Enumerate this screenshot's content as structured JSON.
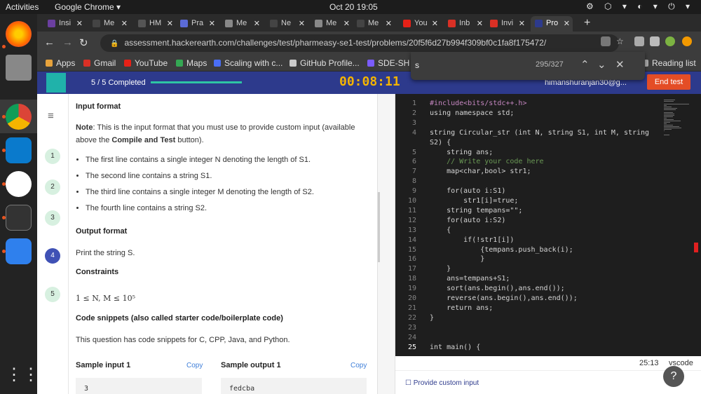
{
  "topbar": {
    "activities": "Activities",
    "app": "Google Chrome ▾",
    "clock": "Oct 20  19:05",
    "tray": "⚙ ⬡ ▾ ◐ ▾ ⏻ ▾"
  },
  "tabs": [
    {
      "label": "Insi",
      "color": "#6b3fa0"
    },
    {
      "label": "Me",
      "color": "#444"
    },
    {
      "label": "HM",
      "color": "#555"
    },
    {
      "label": "Pra",
      "color": "#5b6bd6"
    },
    {
      "label": "Me",
      "color": "#888"
    },
    {
      "label": "Ne",
      "color": "#444"
    },
    {
      "label": "Me",
      "color": "#888"
    },
    {
      "label": "Me",
      "color": "#444"
    },
    {
      "label": "You",
      "color": "#e62117"
    },
    {
      "label": "Inb",
      "color": "#d93025"
    },
    {
      "label": "Invi",
      "color": "#d93025"
    },
    {
      "label": "Pro",
      "color": "#2d3a8c"
    }
  ],
  "url": "assessment.hackerearth.com/challenges/test/pharmeasy-se1-test/problems/20f5f6d27b994f309bf0c1fa8f175472/",
  "bookmarks": [
    {
      "label": "Apps",
      "color": "#e8a33c"
    },
    {
      "label": "Gmail",
      "color": "#d93025"
    },
    {
      "label": "YouTube",
      "color": "#e62117"
    },
    {
      "label": "Maps",
      "color": "#34a853"
    },
    {
      "label": "Scaling with c...",
      "color": "#4a6ef5"
    },
    {
      "label": "GitHub Profile...",
      "color": "#ccc"
    },
    {
      "label": "SDE-SH",
      "color": "#7b5cff"
    },
    {
      "label": "Reading list",
      "color": "#aaa"
    }
  ],
  "find": {
    "query": "s",
    "count": "295/327"
  },
  "header": {
    "completed": "5 / 5 Completed",
    "timer": "00:08:11",
    "user": "himanshuranjan30@g...",
    "end": "End test"
  },
  "sidenav": [
    "1",
    "2",
    "3",
    "4",
    "5"
  ],
  "problem": {
    "input_title": "Input format",
    "note_prefix": "Note",
    "note_text": ": This is the input format that you must use to provide custom input (available above the",
    "note_bold": "Compile and Test",
    "note_end": "button).",
    "bullets": [
      "The first line contains a single integer N denoting the length of S1.",
      "The second line contains a string S1.",
      "The third line contains a single integer M denoting the length of S2.",
      "The fourth line contains a string S2."
    ],
    "output_title": "Output format",
    "output_text": "Print the string S.",
    "constraints_title": "Constraints",
    "constraints_text": "1 ≤ N, M ≤ 10⁵",
    "snippets_title": "Code snippets (also called starter code/boilerplate code)",
    "snippets_text": "This question has code snippets for C, CPP, Java, and Python.",
    "sample_input_title": "Sample input 1",
    "sample_output_title": "Sample output 1",
    "copy": "Copy",
    "sample_input": "3",
    "sample_output": "fedcba"
  },
  "code_lines": [
    "#include<bits/stdc++.h>",
    "using namespace std;",
    "",
    "string Circular_str (int N, string S1, int M, string",
    "S2) {",
    "    string ans;",
    "    // Write your code here",
    "    map<char,bool> str1;",
    "",
    "    for(auto i:S1)",
    "        str1[i]=true;",
    "    string tempans=\"\";",
    "    for(auto i:S2)",
    "    {",
    "        if(!str1[i])",
    "            {tempans.push_back(i);",
    "            }",
    "    }",
    "    ans=tempans+S1;",
    "    sort(ans.begin(),ans.end());",
    "    reverse(ans.begin(),ans.end());",
    "    return ans;",
    "}",
    "",
    "",
    "int main() {"
  ],
  "line_numbers": [
    "1",
    "2",
    "3",
    "4",
    "",
    "5",
    "6",
    "7",
    "8",
    "9",
    "10",
    "11",
    "12",
    "13",
    "14",
    "15",
    "16",
    "17",
    "18",
    "19",
    "20",
    "21",
    "22",
    "23",
    "24",
    "25"
  ],
  "status": {
    "position": "25:13",
    "mode": "vscode"
  },
  "custom_input": "Provide custom input",
  "help": "?"
}
